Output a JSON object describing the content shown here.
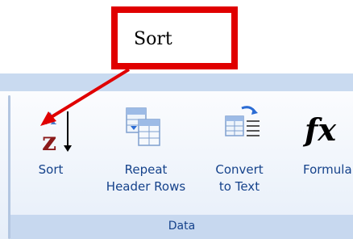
{
  "callout": {
    "text": "Sort"
  },
  "ribbon": {
    "group_label": "Data",
    "buttons": [
      {
        "label": "Sort",
        "icon": "sort-az-icon"
      },
      {
        "label_line1": "Repeat",
        "label_line2": "Header Rows",
        "icon": "repeat-header-rows-icon"
      },
      {
        "label_line1": "Convert",
        "label_line2": "to Text",
        "icon": "convert-to-text-icon"
      },
      {
        "label": "Formula",
        "icon": "formula-fx-icon"
      }
    ]
  },
  "colors": {
    "callout_border": "#e00000",
    "arrow": "#e00000",
    "ribbon_text": "#15428b",
    "ribbon_top": "#c9daf0",
    "group_bar": "#c7d8ef"
  }
}
